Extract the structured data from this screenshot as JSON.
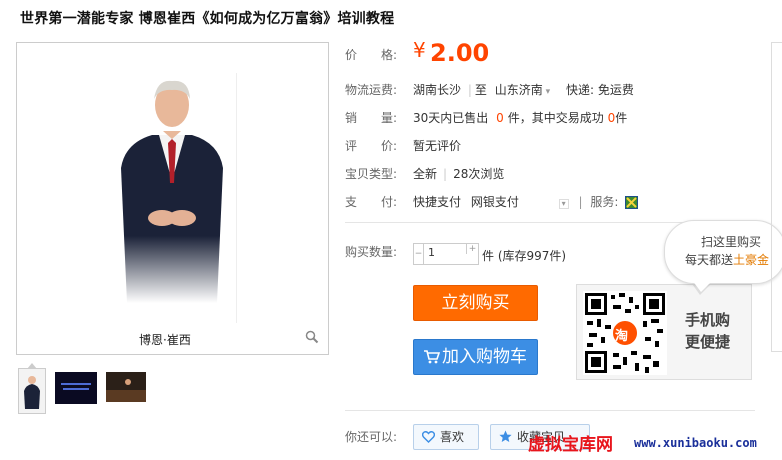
{
  "title": "世界第一潜能专家 博恩崔西《如何成为亿万富翁》培训教程",
  "image": {
    "caption": "博恩·崔西"
  },
  "price": {
    "label": "价　　格:",
    "currency": "¥",
    "value": "2.00"
  },
  "shipping": {
    "label": "物流运费:",
    "from": "湖南长沙",
    "to_sep": "至",
    "to": "山东济南",
    "method": "快递: 免运费"
  },
  "sales": {
    "label": "销　　量:",
    "prefix": "30天内已售出",
    "sold": "0",
    "mid": "件，其中交易成功",
    "success": "0",
    "suffix": "件"
  },
  "review": {
    "label": "评　　价:",
    "value": "暂无评价"
  },
  "condition": {
    "label": "宝贝类型:",
    "type": "全新",
    "views": "28次浏览"
  },
  "payment": {
    "label": "支　　付:",
    "methods": [
      "快捷支付",
      "网银支付"
    ],
    "service_label": "服务:"
  },
  "quantity": {
    "label": "购买数量:",
    "value": "1",
    "stock": "件 (库存997件)"
  },
  "buttons": {
    "buy": "立刻购买",
    "cart": "加入购物车"
  },
  "mobile": {
    "line1": "手机购",
    "line2": "更便捷",
    "qr_badge": "淘"
  },
  "bubble": {
    "line1": "扫这里购买",
    "line2_prefix": "每天都送",
    "line2_highlight": "土豪金"
  },
  "actions": {
    "label": "你还可以:",
    "like": "喜欢",
    "fav": "收藏宝贝"
  },
  "watermark": {
    "cn": "虚拟宝库网",
    "en": "www.xunibaoku.com"
  },
  "colors": {
    "price": "#ff4400",
    "buy": "#ff6a00",
    "cart": "#3c8ee4",
    "watermark": "#e8151c"
  }
}
